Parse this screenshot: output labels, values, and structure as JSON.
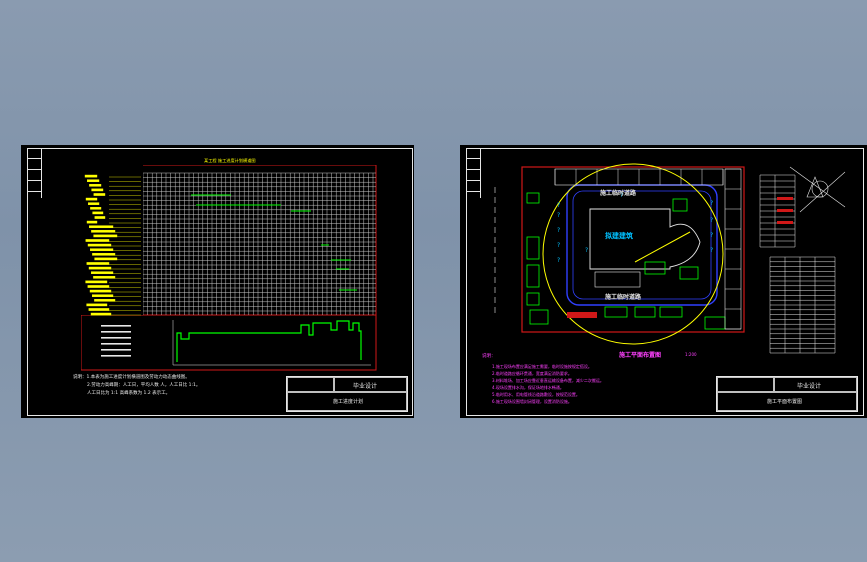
{
  "left_sheet": {
    "schedule_title": "某工程 施工进度计划横道图",
    "notes": [
      "说明：1.本表为施工进度计划横道图及劳动力动态曲线图。",
      "2.劳动力高峰期：人工日，平均人数  人，人工日比 1:1。",
      "人工日比为 1:1 高峰系数为 1.2 表示工。"
    ],
    "title_block": {
      "design_name": "毕业设计",
      "drawing_name": "施工进度计划"
    }
  },
  "right_sheet": {
    "road_label_top": "施工临时道路",
    "road_label_bottom": "施工临时道路",
    "building_label": "拟建建筑",
    "plan_title": "施工平面布置图",
    "plan_scale": "1:200",
    "notes_header": "说明：",
    "notes": [
      "1.施工现场布置应满足施工需要，临时设施按规定搭设。",
      "2.临时道路应循环贯通，宽度满足消防要求。",
      "3.材料堆场、加工场应靠近垂直运输设备布置，减少二次搬运。",
      "4.现场设置排水沟，保证场地排水畅通。",
      "5.临时用水、用电管线沿道路敷设，按规范设置。",
      "6.施工现场设围墙封闭管理，设置消防设施。"
    ],
    "title_block": {
      "design_name": "毕业设计",
      "drawing_name": "施工平面布置图"
    }
  },
  "colors": {
    "background": "#8a9bb0",
    "sheet": "#000000",
    "frame": "#e6e6e6",
    "red": "#d01818",
    "yellow": "#ffff00",
    "green": "#00ff00",
    "blue": "#3040ff",
    "cyan": "#00c0ff",
    "magenta": "#ff40ff"
  }
}
